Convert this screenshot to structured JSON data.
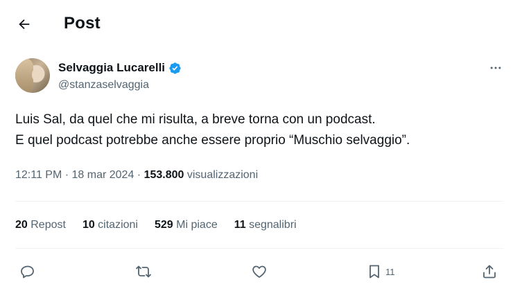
{
  "header": {
    "title": "Post"
  },
  "author": {
    "name": "Selvaggia Lucarelli",
    "handle": "@stanzaselvaggia"
  },
  "tweet": {
    "lines": [
      "Luis Sal, da quel che mi risulta, a breve torna con un podcast.",
      "E quel podcast potrebbe anche essere proprio “Muschio selvaggio”."
    ]
  },
  "meta": {
    "time": "12:11 PM",
    "separator1": " · ",
    "date": "18 mar 2024",
    "separator2": " · ",
    "views_count": "153.800",
    "views_label": " visualizzazioni"
  },
  "stats": {
    "reposts": {
      "num": "20",
      "label": " Repost"
    },
    "quotes": {
      "num": "10",
      "label": " citazioni"
    },
    "likes": {
      "num": "529",
      "label": " Mi piace"
    },
    "bookmarks": {
      "num": "11",
      "label": " segnalibri"
    }
  },
  "actions": {
    "bookmark_count": "11"
  },
  "colors": {
    "text": "#0f1419",
    "secondary": "#536471",
    "verified": "#1d9bf0",
    "divider": "#eff3f4"
  }
}
